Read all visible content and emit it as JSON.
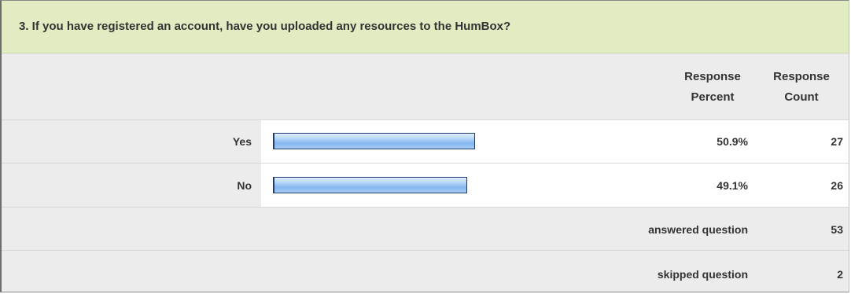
{
  "question": {
    "title": "3. If you have registered an account, have you uploaded any resources to the HumBox?"
  },
  "headers": {
    "percent_line1": "Response",
    "percent_line2": "Percent",
    "count_line1": "Response",
    "count_line2": "Count"
  },
  "chart_data": {
    "type": "bar",
    "categories": [
      "Yes",
      "No"
    ],
    "values": [
      50.9,
      49.1
    ],
    "value_labels": [
      "50.9%",
      "49.1%"
    ],
    "counts": [
      "27",
      "26"
    ],
    "xlim": [
      0,
      100
    ],
    "unit": "%"
  },
  "summary": {
    "answered_label": "answered question",
    "answered_value": "53",
    "skipped_label": "skipped question",
    "skipped_value": "2"
  },
  "colors": {
    "header_bg": "#e1ecc3",
    "bar_fill": "#84b7ef",
    "bar_border": "#1b3f74",
    "row_bg": "#ececec"
  }
}
